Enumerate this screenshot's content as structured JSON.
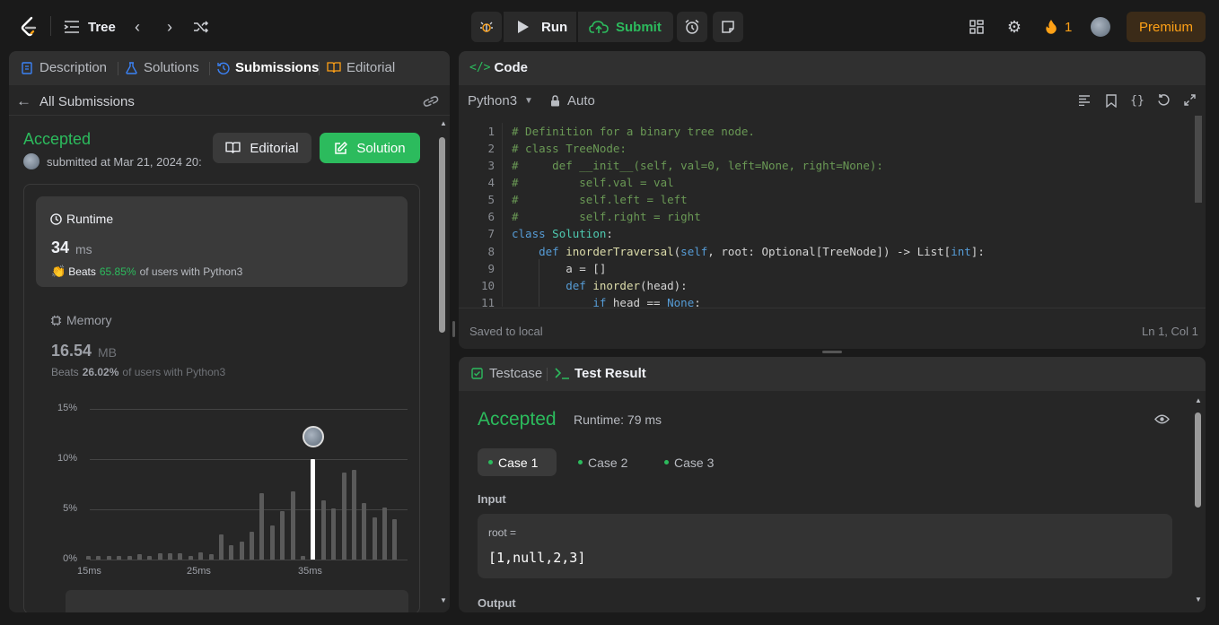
{
  "topbar": {
    "problem_list": "Tree",
    "run_label": "Run",
    "submit_label": "Submit",
    "streak_count": "1",
    "premium_label": "Premium"
  },
  "left": {
    "tabs": [
      "Description",
      "Solutions",
      "Submissions",
      "Editorial"
    ],
    "back_label": "All Submissions",
    "status": "Accepted",
    "submitted_at": "submitted at Mar 21, 2024 20:",
    "editorial_btn": "Editorial",
    "solution_btn": "Solution",
    "runtime": {
      "title": "Runtime",
      "value": "34",
      "unit": "ms",
      "beats_prefix": "Beats",
      "beats_pct": "65.85%",
      "beats_suffix": "of users with Python3"
    },
    "memory": {
      "title": "Memory",
      "value": "16.54",
      "unit": "MB",
      "beats_prefix": "Beats",
      "beats_pct": "26.02%",
      "beats_suffix": "of users with Python3"
    }
  },
  "chart_data": {
    "type": "bar",
    "y_ticks": [
      "15%",
      "10%",
      "5%",
      "0%"
    ],
    "x_ticks": [
      "15ms",
      "25ms",
      "35ms"
    ],
    "ylim": [
      0,
      15
    ],
    "categories": [
      "15",
      "16",
      "17",
      "18",
      "19",
      "20",
      "21",
      "22",
      "23",
      "24",
      "25",
      "26",
      "27",
      "28",
      "29",
      "30",
      "31",
      "32",
      "33",
      "34",
      "35",
      "36",
      "37",
      "38",
      "39",
      "40",
      "41",
      "42"
    ],
    "values": [
      0.4,
      0.4,
      0.4,
      0.4,
      0.4,
      0.5,
      0.4,
      0.6,
      0.6,
      0.6,
      0.4,
      0.7,
      0.5,
      2.5,
      1.4,
      1.8,
      2.8,
      6.6,
      3.4,
      4.8,
      6.8,
      0.4,
      10.0,
      5.9,
      5.1,
      8.7,
      8.9,
      5.6,
      4.2,
      5.2,
      4.0
    ],
    "highlight_index": 22,
    "grid": true
  },
  "code": {
    "header": "Code",
    "language": "Python3",
    "mode": "Auto",
    "saved": "Saved to local",
    "cursor": "Ln 1, Col 1",
    "lines": [
      "1",
      "2",
      "3",
      "4",
      "5",
      "6",
      "7",
      "8",
      "9",
      "10",
      "11"
    ]
  },
  "result": {
    "tabs": [
      "Testcase",
      "Test Result"
    ],
    "status": "Accepted",
    "runtime": "Runtime: 79 ms",
    "cases": [
      "Case 1",
      "Case 2",
      "Case 3"
    ],
    "input_label": "Input",
    "var_name": "root =",
    "var_value": "[1,null,2,3]",
    "output_label": "Output"
  },
  "colors": {
    "accent_green": "#2cbb5d",
    "premium": "#ffa116"
  }
}
